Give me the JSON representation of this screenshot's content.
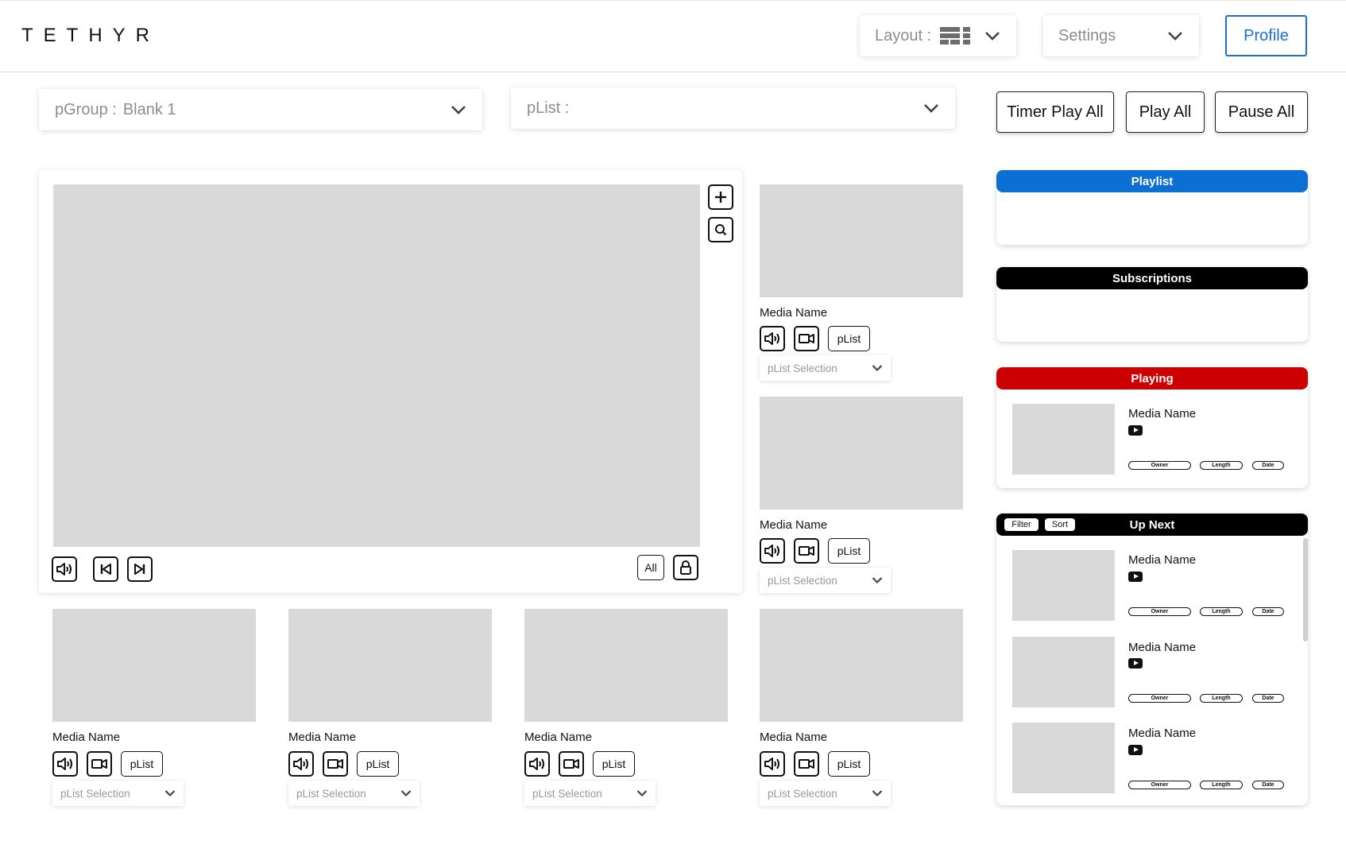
{
  "header": {
    "brand": "TETHYR",
    "layout_label": "Layout :",
    "settings_label": "Settings",
    "profile_label": "Profile"
  },
  "controls": {
    "pgroup_key": "pGroup :",
    "pgroup_value": "Blank 1",
    "plist_key": "pList :",
    "timer_play_all": "Timer Play All",
    "play_all": "Play All",
    "pause_all": "Pause All"
  },
  "player": {
    "all_label": "All"
  },
  "tiles": [
    {
      "name": "Media Name",
      "plist": "pList",
      "selection": "pList Selection"
    },
    {
      "name": "Media Name",
      "plist": "pList",
      "selection": "pList Selection"
    },
    {
      "name": "Media Name",
      "plist": "pList",
      "selection": "pList Selection"
    },
    {
      "name": "Media Name",
      "plist": "pList",
      "selection": "pList Selection"
    },
    {
      "name": "Media Name",
      "plist": "pList",
      "selection": "pList Selection"
    },
    {
      "name": "Media Name",
      "plist": "pList",
      "selection": "pList Selection"
    }
  ],
  "panels": {
    "playlist": {
      "title": "Playlist",
      "color": "#0b6fd4"
    },
    "subscriptions": {
      "title": "Subscriptions",
      "color": "#000000"
    },
    "playing": {
      "title": "Playing",
      "color": "#cc0000",
      "item": {
        "name": "Media Name",
        "owner": "Owner",
        "length": "Length",
        "date": "Date"
      }
    },
    "up_next": {
      "title": "Up Next",
      "color": "#000000",
      "filter": "Filter",
      "sort": "Sort",
      "items": [
        {
          "name": "Media Name",
          "owner": "Owner",
          "length": "Length",
          "date": "Date"
        },
        {
          "name": "Media Name",
          "owner": "Owner",
          "length": "Length",
          "date": "Date"
        },
        {
          "name": "Media Name",
          "owner": "Owner",
          "length": "Length",
          "date": "Date"
        }
      ]
    }
  },
  "icons": [
    "volume-icon",
    "video-camera-icon",
    "skip-back-icon",
    "skip-forward-icon",
    "lock-icon",
    "plus-icon",
    "search-icon",
    "chevron-down-icon",
    "youtube-icon",
    "layout-grid-icon"
  ]
}
